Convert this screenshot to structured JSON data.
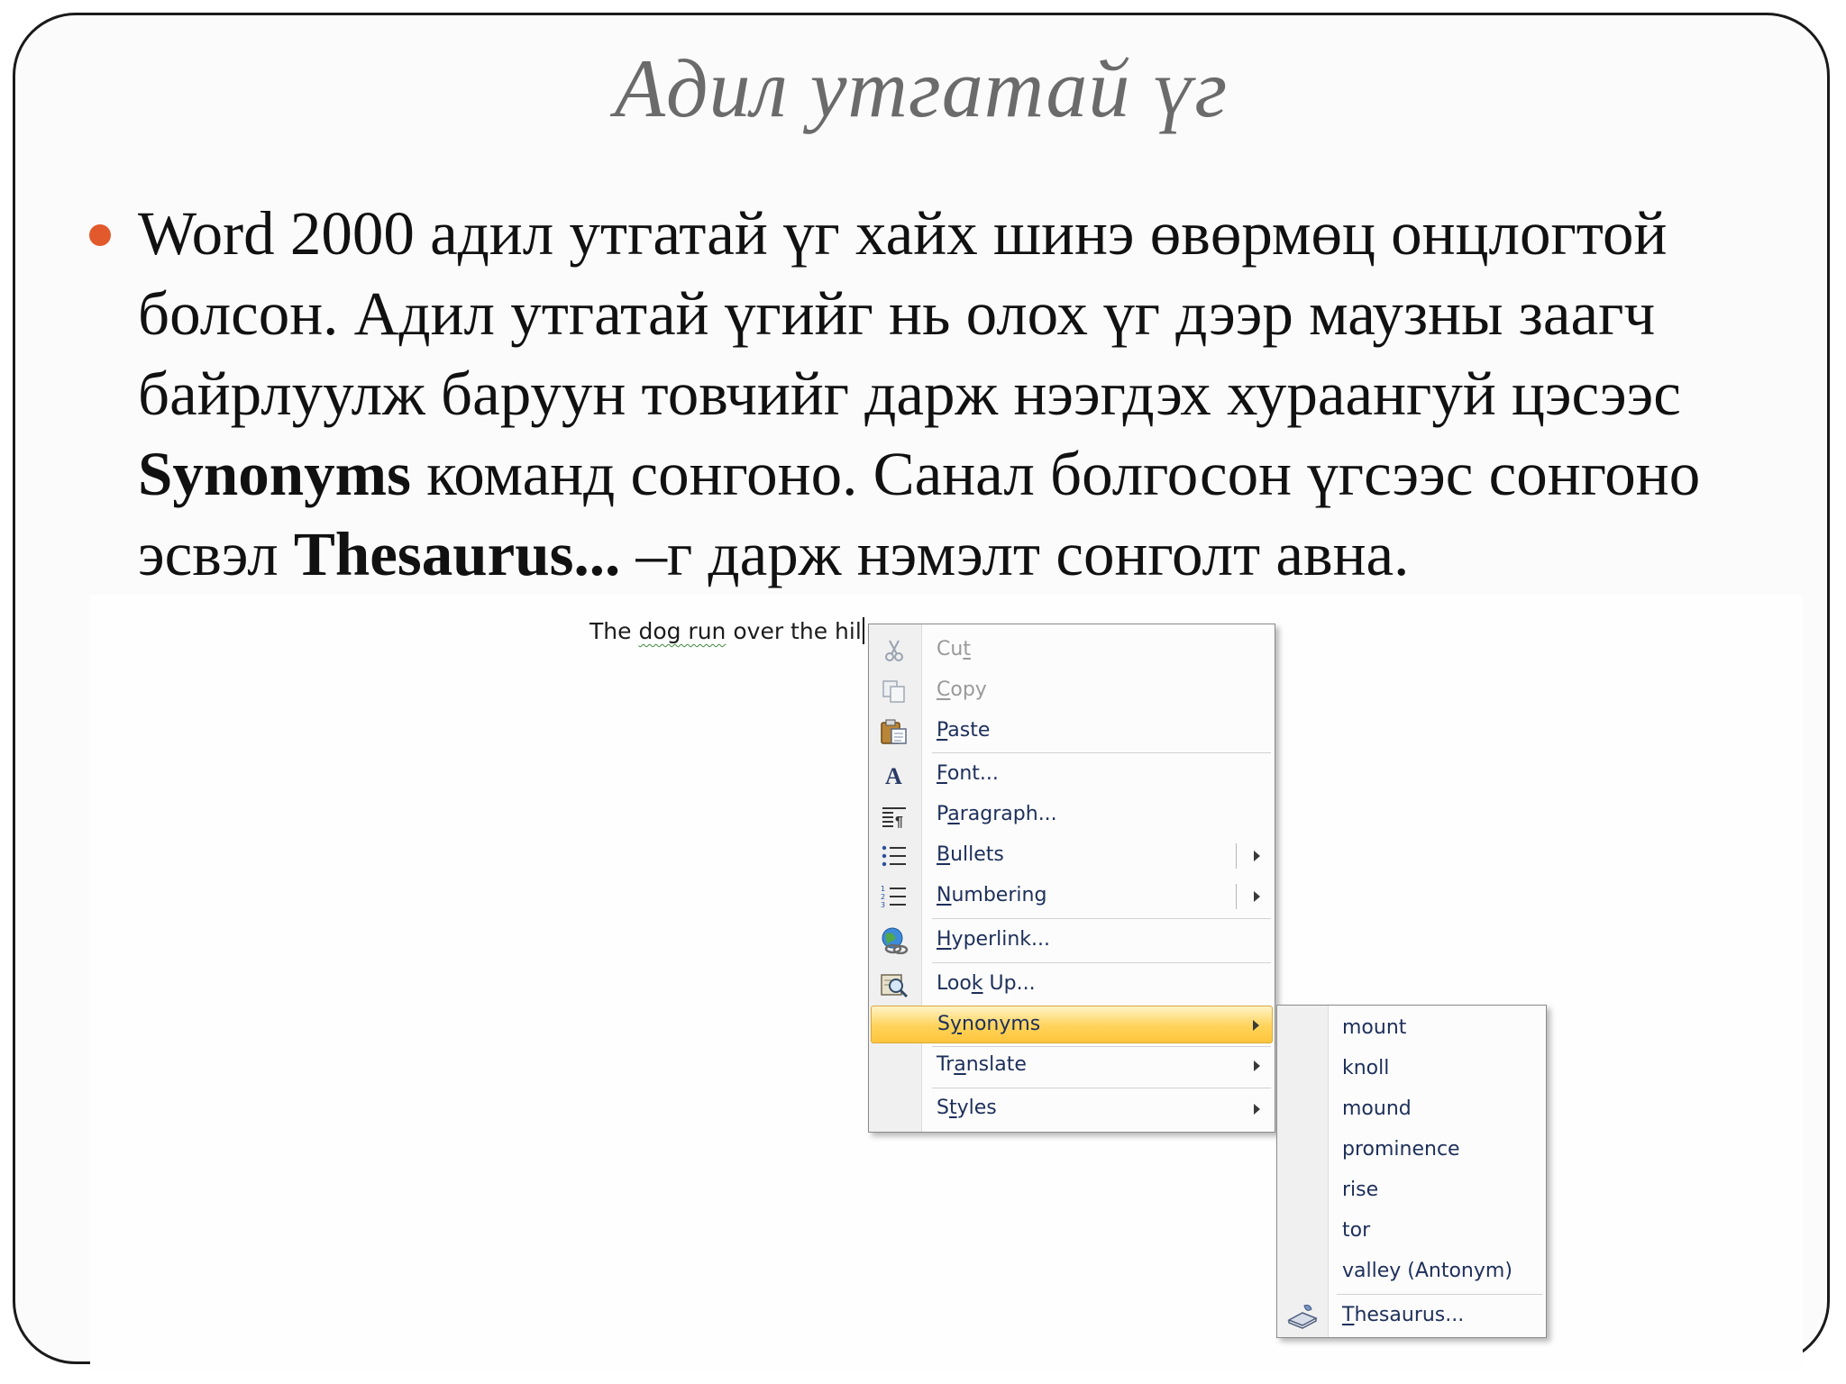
{
  "slide": {
    "title": "Адил утгатай үг",
    "paragraph": {
      "part1": "Word 2000 адил утгатай үг хайх шинэ өвөрмөц онцлогтой болсон. Адил утгатай үгийг нь олох үг дээр маузны заагч байрлуулж баруун товчийг дарж нээгдэх хураангуй цэсээс ",
      "bold1": "Synonyms",
      "part2": " команд сонгоно. Санал болгосон үгсээс сонгоно эсвэл ",
      "bold2": "Thesaurus...",
      "part3": " –г дарж нэмэлт сонголт авна."
    },
    "bullet_color": "#e2592c"
  },
  "document": {
    "pre": "The ",
    "misspelled": "dog run",
    "post": " over the hil"
  },
  "context_menu": {
    "items": [
      {
        "id": "cut",
        "label": "Cut",
        "accesskey": "t",
        "enabled": false,
        "icon": "scissors-icon"
      },
      {
        "id": "copy",
        "label": "Copy",
        "accesskey": "C",
        "enabled": false,
        "icon": "copy-icon"
      },
      {
        "id": "paste",
        "label": "Paste",
        "accesskey": "P",
        "enabled": true,
        "icon": "paste-icon"
      },
      {
        "id": "font",
        "label": "Font...",
        "accesskey": "F",
        "enabled": true,
        "icon": "font-icon"
      },
      {
        "id": "paragraph",
        "label": "Paragraph...",
        "accesskey": "a",
        "enabled": true,
        "icon": "paragraph-icon"
      },
      {
        "id": "bullets",
        "label": "Bullets",
        "accesskey": "B",
        "enabled": true,
        "icon": "bullets-icon",
        "submenu": true
      },
      {
        "id": "numbering",
        "label": "Numbering",
        "accesskey": "N",
        "enabled": true,
        "icon": "numbering-icon",
        "submenu": true
      },
      {
        "id": "hyperlink",
        "label": "Hyperlink...",
        "accesskey": "H",
        "enabled": true,
        "icon": "hyperlink-icon"
      },
      {
        "id": "lookup",
        "label": "Look Up...",
        "accesskey": "k",
        "enabled": true,
        "icon": "research-icon"
      },
      {
        "id": "synonyms",
        "label": "Synonyms",
        "accesskey": "y",
        "enabled": true,
        "highlighted": true,
        "submenu": true
      },
      {
        "id": "translate",
        "label": "Translate",
        "accesskey": "a",
        "enabled": true,
        "submenu": true
      },
      {
        "id": "styles",
        "label": "Styles",
        "accesskey": "t",
        "enabled": true,
        "submenu": true
      }
    ]
  },
  "synonyms_submenu": {
    "items": [
      "mount",
      "knoll",
      "mound",
      "prominence",
      "rise",
      "tor",
      "valley (Antonym)"
    ],
    "thesaurus_label": "Thesaurus...",
    "thesaurus_icon": "thesaurus-icon"
  }
}
